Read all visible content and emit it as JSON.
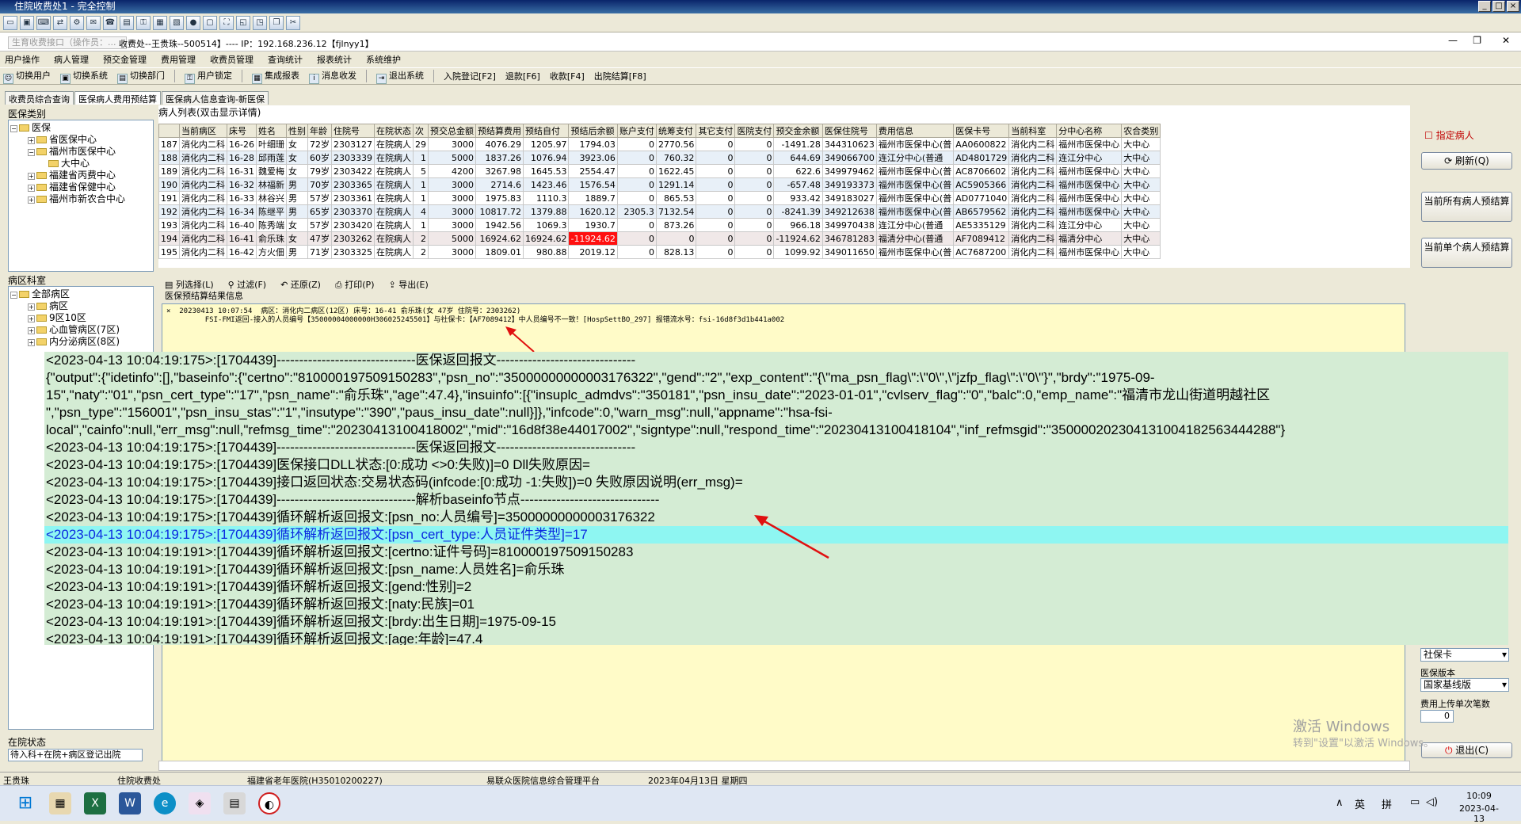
{
  "window": {
    "title": "住院收费处1 - 完全控制"
  },
  "infobar": {
    "hint": "生育收费接口（操作员：...",
    "conn": "收费处--王贵珠--500514】---- IP：192.168.236.12【fjlnyy1】"
  },
  "menu": [
    "用户操作",
    "病人管理",
    "预交金管理",
    "费用管理",
    "收费员管理",
    "查询统计",
    "报表统计",
    "系统维护"
  ],
  "toolbar": [
    "切换用户",
    "切换系统",
    "切换部门",
    "用户锁定",
    "集成报表",
    "消息收发",
    "退出系统",
    "入院登记[F2]",
    "退款[F6]",
    "收款[F4]",
    "出院结算[F8]"
  ],
  "tabs": [
    "收费员综合查询",
    "医保病人费用预结算",
    "医保病人信息查询-新医保"
  ],
  "left": {
    "insurance_header": "医保类别",
    "insurance_tree": [
      "医保",
      "省医保中心",
      "福州市医保中心",
      "大中心",
      "福建省丙费中心",
      "福建省保健中心",
      "福州市新农合中心"
    ],
    "ward_header": "病区科室",
    "ward_tree": [
      "全部病区",
      "病区",
      "9区10区",
      "心血管病区(7区)",
      "内分泌病区(8区)"
    ],
    "state_header": "在院状态",
    "state_value": "待入科+在院+病区登记出院"
  },
  "grid": {
    "title": "病人列表(双击显示详情)",
    "columns": [
      "",
      "当前病区",
      "床号",
      "姓名",
      "性别",
      "年龄",
      "住院号",
      "在院状态",
      "次",
      "预交总金额",
      "预结算费用",
      "预结自付",
      "预结后余额",
      "账户支付",
      "统筹支付",
      "其它支付",
      "医院支付",
      "预交金余额",
      "医保住院号",
      "费用信息",
      "医保卡号",
      "当前科室",
      "分中心名称",
      "农合类别"
    ],
    "rows": [
      [
        "187",
        "消化内二科",
        "16-26",
        "叶细珊",
        "女",
        "72岁",
        "2303127",
        "在院病人",
        "29",
        "3000",
        "4076.29",
        "1205.97",
        "1794.03",
        "0",
        "2770.56",
        "0",
        "0",
        "-1491.28",
        "344310623",
        "福州市医保中心(普",
        "AA0600822",
        "消化内二科",
        "福州市医保中心",
        "大中心"
      ],
      [
        "188",
        "消化内二科",
        "16-28",
        "邱雨莲",
        "女",
        "60岁",
        "2303339",
        "在院病人",
        "1",
        "5000",
        "1837.26",
        "1076.94",
        "3923.06",
        "0",
        "760.32",
        "0",
        "0",
        "644.69",
        "349066700",
        "连江分中心(普通",
        "AD4801729",
        "消化内二科",
        "连江分中心",
        "大中心"
      ],
      [
        "189",
        "消化内二科",
        "16-31",
        "魏爱梅",
        "女",
        "79岁",
        "2303422",
        "在院病人",
        "5",
        "4200",
        "3267.98",
        "1645.53",
        "2554.47",
        "0",
        "1622.45",
        "0",
        "0",
        "622.6",
        "349979462",
        "福州市医保中心(普",
        "AC8706602",
        "消化内二科",
        "福州市医保中心",
        "大中心"
      ],
      [
        "190",
        "消化内二科",
        "16-32",
        "林福新",
        "男",
        "70岁",
        "2303365",
        "在院病人",
        "1",
        "3000",
        "2714.6",
        "1423.46",
        "1576.54",
        "0",
        "1291.14",
        "0",
        "0",
        "-657.48",
        "349193373",
        "福州市医保中心(普",
        "AC5905366",
        "消化内二科",
        "福州市医保中心",
        "大中心"
      ],
      [
        "191",
        "消化内二科",
        "16-33",
        "林谷兴",
        "男",
        "57岁",
        "2303361",
        "在院病人",
        "1",
        "3000",
        "1975.83",
        "1110.3",
        "1889.7",
        "0",
        "865.53",
        "0",
        "0",
        "933.42",
        "349183027",
        "福州市医保中心(普",
        "AD0771040",
        "消化内二科",
        "福州市医保中心",
        "大中心"
      ],
      [
        "192",
        "消化内二科",
        "16-34",
        "陈继平",
        "男",
        "65岁",
        "2303370",
        "在院病人",
        "4",
        "3000",
        "10817.72",
        "1379.88",
        "1620.12",
        "2305.3",
        "7132.54",
        "0",
        "0",
        "-8241.39",
        "349212638",
        "福州市医保中心(普",
        "AB6579562",
        "消化内二科",
        "福州市医保中心",
        "大中心"
      ],
      [
        "193",
        "消化内二科",
        "16-40",
        "陈秀端",
        "女",
        "57岁",
        "2303420",
        "在院病人",
        "1",
        "3000",
        "1942.56",
        "1069.3",
        "1930.7",
        "0",
        "873.26",
        "0",
        "0",
        "966.18",
        "349970438",
        "连江分中心(普通",
        "AE5335129",
        "消化内二科",
        "连江分中心",
        "大中心"
      ],
      [
        "194",
        "消化内二科",
        "16-41",
        "俞乐珠",
        "女",
        "47岁",
        "2303262",
        "在院病人",
        "2",
        "5000",
        "16924.62",
        "16924.62",
        "-11924.62",
        "0",
        "0",
        "0",
        "0",
        "-11924.62",
        "346781283",
        "福清分中心(普通",
        "AF7089412",
        "消化内二科",
        "福清分中心",
        "大中心"
      ],
      [
        "195",
        "消化内二科",
        "16-42",
        "方火佃",
        "男",
        "71岁",
        "2303325",
        "在院病人",
        "2",
        "3000",
        "1809.01",
        "980.88",
        "2019.12",
        "0",
        "828.13",
        "0",
        "0",
        "1099.92",
        "349011650",
        "福州市医保中心(普",
        "AC7687200",
        "消化内二科",
        "福州市医保中心",
        "大中心"
      ]
    ]
  },
  "right": {
    "specify": "指定病人",
    "refresh": "刷新(Q)",
    "all_calc": "当前所有病人预结算",
    "single_calc": "当前单个病人预结算",
    "card_type": "社保卡",
    "version_label": "医保版本",
    "version": "国家基线版",
    "upload_label": "费用上传单次笔数",
    "upload_value": "0",
    "exit": "退出(C)"
  },
  "bottomtools": [
    "列选择(L)",
    "过滤(F)",
    "还原(Z)",
    "打印(P)",
    "导出(E)"
  ],
  "result": {
    "title": "医保预结算结果信息",
    "line1": "×  20230413 10:07:54  病区：消化内二病区(12区) 床号：16-41 俞乐珠(女 47岁 住院号：2303262)",
    "line2": "         FSI-FMI返回-接入的人员编号【35000004000000H306025245501】与社保卡：【AF7089412】中人员编号不一致！[HospSettBO_297] 报错流水号：fsi-16d8f3d1b441a002"
  },
  "log": [
    "<2023-04-13 10:04:19:175>:[1704439]-------------------------------医保返回报文-------------------------------",
    "{\"output\":{\"idetinfo\":[],\"baseinfo\":{\"certno\":\"810000197509150283\",\"psn_no\":\"35000000000003176322\",\"gend\":\"2\",\"exp_content\":\"{\\\"ma_psn_flag\\\":\\\"0\\\",\\\"jzfp_flag\\\":\\\"0\\\"}\",\"brdy\":\"1975-09-",
    "15\",\"naty\":\"01\",\"psn_cert_type\":\"17\",\"psn_name\":\"俞乐珠\",\"age\":47.4},\"insuinfo\":[{\"insuplc_admdvs\":\"350181\",\"psn_insu_date\":\"2023-01-01\",\"cvlserv_flag\":\"0\",\"balc\":0,\"emp_name\":\"福清市龙山街道明越社区",
    "\",\"psn_type\":\"156001\",\"psn_insu_stas\":\"1\",\"insutype\":\"390\",\"paus_insu_date\":null}]},\"infcode\":0,\"warn_msg\":null,\"appname\":\"hsa-fsi-",
    "local\",\"cainfo\":null,\"err_msg\":null,\"refmsg_time\":\"20230413100418002\",\"mid\":\"16d8f38e44017002\",\"signtype\":null,\"respond_time\":\"20230413100418104\",\"inf_refmsgid\":\"350000202304131004182563444288\"}",
    "<2023-04-13 10:04:19:175>:[1704439]-------------------------------医保返回报文-------------------------------",
    "<2023-04-13 10:04:19:175>:[1704439]医保接口DLL状态:[0:成功 <>0:失败)]=0 Dll失败原因=",
    "<2023-04-13 10:04:19:175>:[1704439]接口返回状态:交易状态码(infcode:[0:成功 -1:失败])=0 失败原因说明(err_msg)=",
    "<2023-04-13 10:04:19:175>:[1704439]-------------------------------解析baseinfo节点-------------------------------",
    "<2023-04-13 10:04:19:175>:[1704439]循环解析返回报文:[psn_no:人员编号]=35000000000003176322",
    "<2023-04-13 10:04:19:175>:[1704439]循环解析返回报文:[psn_cert_type:人员证件类型]=17",
    "<2023-04-13 10:04:19:191>:[1704439]循环解析返回报文:[certno:证件号码]=810000197509150283",
    "<2023-04-13 10:04:19:191>:[1704439]循环解析返回报文:[psn_name:人员姓名]=俞乐珠",
    "<2023-04-13 10:04:19:191>:[1704439]循环解析返回报文:[gend:性别]=2",
    "<2023-04-13 10:04:19:191>:[1704439]循环解析返回报文:[naty:民族]=01",
    "<2023-04-13 10:04:19:191>:[1704439]循环解析返回报文:[brdy:出生日期]=1975-09-15",
    "<2023-04-13 10:04:19:191>:[1704439]循环解析返回报文:[age:年龄]=47.4"
  ],
  "statusbar": {
    "user": "王贵珠",
    "dept": "住院收费处",
    "hospital": "福建省老年医院(H35010200227)",
    "platform": "易联众医院信息综合管理平台",
    "date": "2023年04月13日  星期四"
  },
  "watermark": {
    "line1": "激活 Windows",
    "line2": "转到\"设置\"以激活 Windows。"
  },
  "taskbar": {
    "ime1": "英",
    "ime2": "拼",
    "time": "10:09",
    "date": "2023-04-13"
  }
}
